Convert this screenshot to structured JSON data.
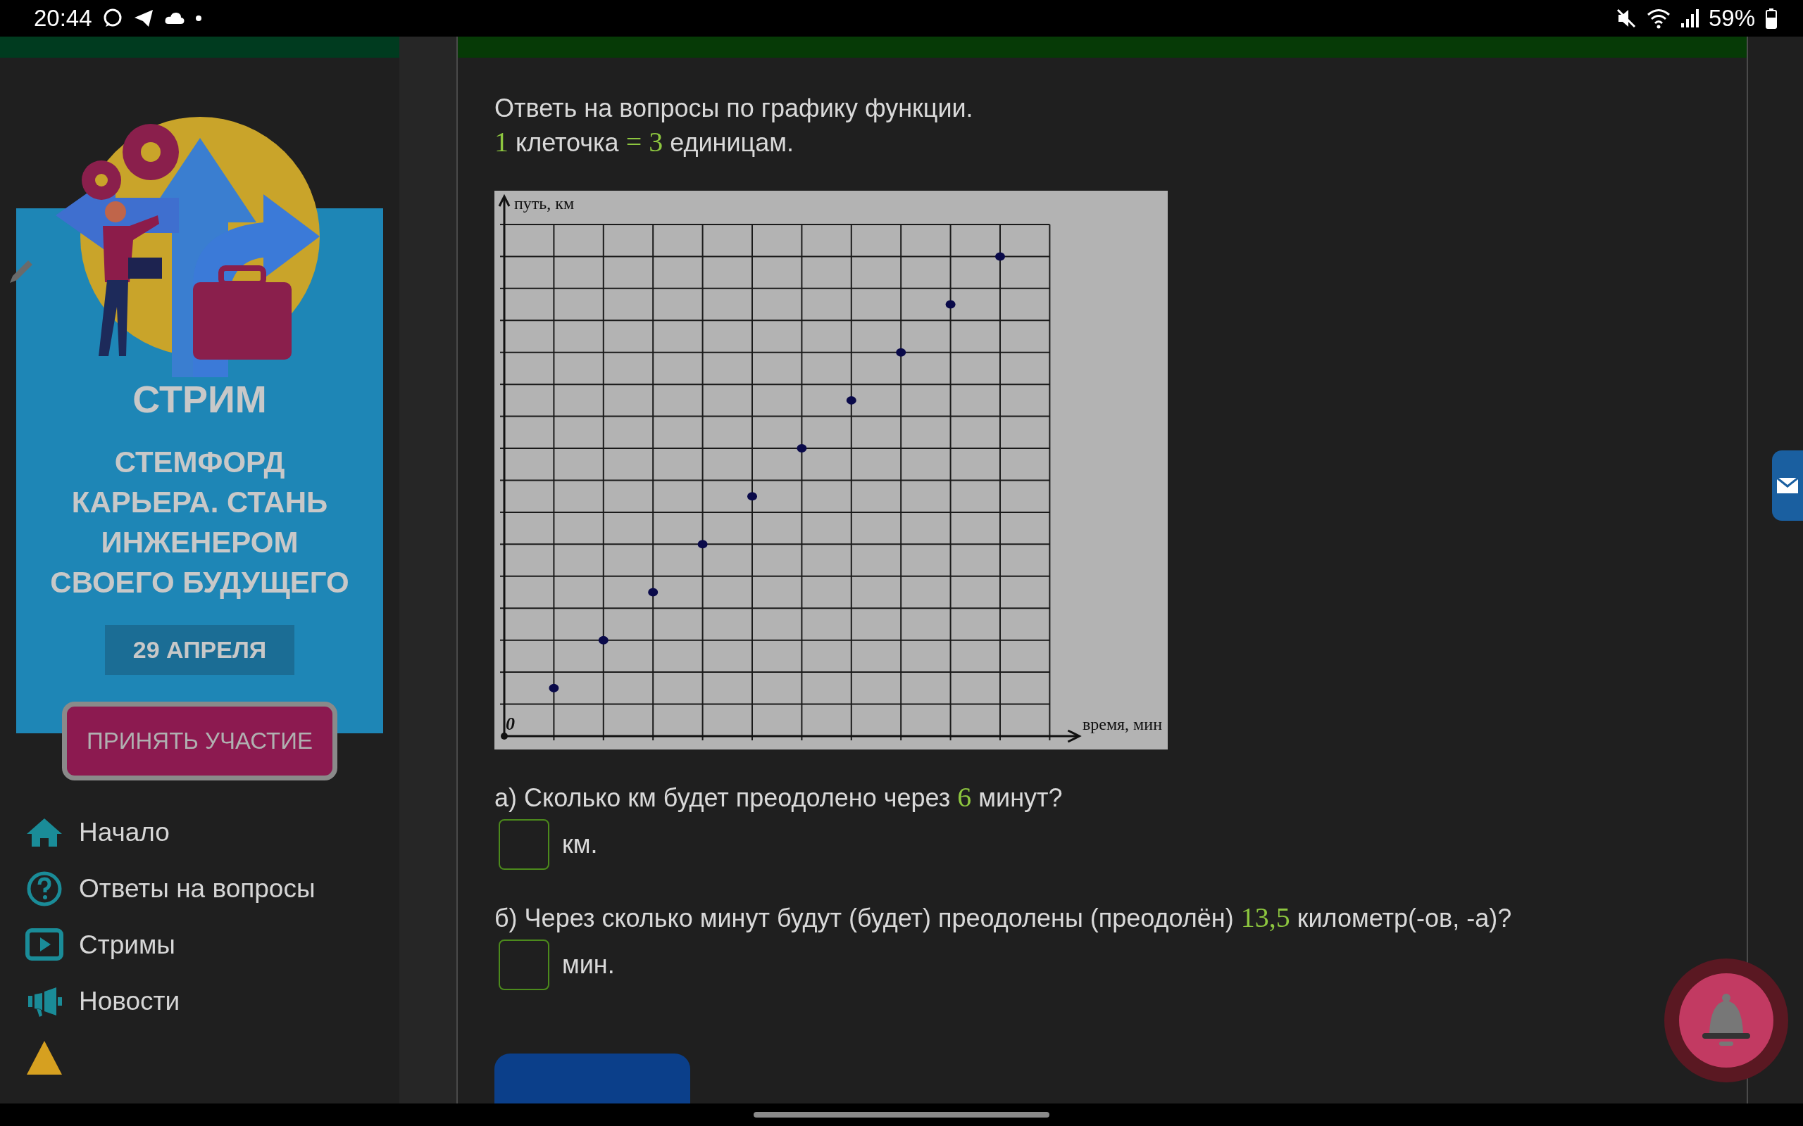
{
  "status_bar": {
    "time": "20:44",
    "battery": "59%"
  },
  "sidebar": {
    "promo": {
      "kind": "picture",
      "eyebrow": "СТРИМ",
      "title": "СТЕМФОРД КАРЬЕРА. СТАНЬ ИНЖЕНЕРОМ СВОЕГО БУДУЩЕГО",
      "date": "29 АПРЕЛЯ",
      "button": "ПРИНЯТЬ УЧАСТИЕ"
    },
    "items": [
      {
        "kind": "home",
        "label": "Начало"
      },
      {
        "kind": "help",
        "label": "Ответы на вопросы"
      },
      {
        "kind": "video",
        "label": "Стримы"
      },
      {
        "kind": "news",
        "label": "Новости"
      },
      {
        "kind": "top"
      }
    ]
  },
  "main": {
    "instructions": [
      {
        "parts": [
          {
            "kind": "text",
            "text": "Ответь на вопросы по графику функции."
          }
        ]
      },
      {
        "parts": [
          {
            "kind": "math",
            "text": "1"
          },
          {
            "kind": "text",
            "text": " клеточка "
          },
          {
            "kind": "math",
            "text": "= 3"
          },
          {
            "kind": "text",
            "text": " единицам."
          }
        ]
      }
    ],
    "graph": {
      "y_label": "путь, км",
      "x_label": "время, мин",
      "origin_label": "0"
    },
    "questions": [
      {
        "parts": [
          {
            "kind": "text",
            "text": "а) Сколько км будет преодолено через "
          },
          {
            "kind": "math",
            "text": "6"
          },
          {
            "kind": "text",
            "text": " минут?"
          }
        ],
        "unit": "км."
      },
      {
        "parts": [
          {
            "kind": "text",
            "text": "б) Через сколько минут будут (будет) преодолены (преодолён) "
          },
          {
            "kind": "math",
            "text": "13,5"
          },
          {
            "kind": "text",
            "text": " километр(-ов, -а)?"
          }
        ],
        "unit": "мин."
      }
    ]
  }
}
